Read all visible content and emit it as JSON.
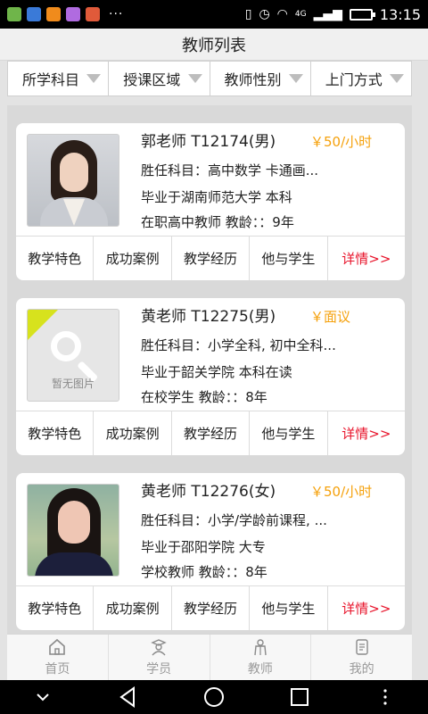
{
  "status_bar": {
    "dots": "···",
    "network": "4G",
    "time": "13:15",
    "app_icon_colors": [
      "#6fb54a",
      "#3a7ad8",
      "#f08b1c",
      "#b06be0",
      "#e05a3a"
    ]
  },
  "header": {
    "title": "教师列表"
  },
  "filters": [
    {
      "label": "所学科目"
    },
    {
      "label": "授课区域"
    },
    {
      "label": "教师性别"
    },
    {
      "label": "上门方式"
    }
  ],
  "teachers": [
    {
      "name": "郭老师   T12174(男)",
      "price": "￥50/小时",
      "subjects": "胜任科目：高中数学   卡通画...",
      "education": "毕业于湖南师范大学   本科",
      "status": "在职高中教师   教龄：：9年",
      "actions": [
        "教学特色",
        "成功案例",
        "教学经历",
        "他与学生",
        "详情>>"
      ]
    },
    {
      "name": "黄老师   T12275(男)",
      "price": "￥面议",
      "photo_placeholder": "暂无图片",
      "subjects": "胜任科目：小学全科, 初中全科...",
      "education": "毕业于韶关学院   本科在读",
      "status": "在校学生   教龄：：8年",
      "actions": [
        "教学特色",
        "成功案例",
        "教学经历",
        "他与学生",
        "详情>>"
      ]
    },
    {
      "name": "黄老师   T12276(女)",
      "price": "￥50/小时",
      "subjects": "胜任科目：小学/学龄前课程, ...",
      "education": "毕业于邵阳学院   大专",
      "status": "学校教师   教龄：：8年",
      "actions": [
        "教学特色",
        "成功案例",
        "教学经历",
        "他与学生",
        "详情>>"
      ]
    }
  ],
  "bottom_nav": [
    {
      "label": "首页",
      "icon": "home-icon"
    },
    {
      "label": "学员",
      "icon": "student-icon"
    },
    {
      "label": "教师",
      "icon": "teacher-icon"
    },
    {
      "label": "我的",
      "icon": "profile-icon"
    }
  ],
  "colors": {
    "price": "#f5a10c",
    "detail_link": "#e8142b",
    "placeholder_accent": "#d7e21d"
  }
}
